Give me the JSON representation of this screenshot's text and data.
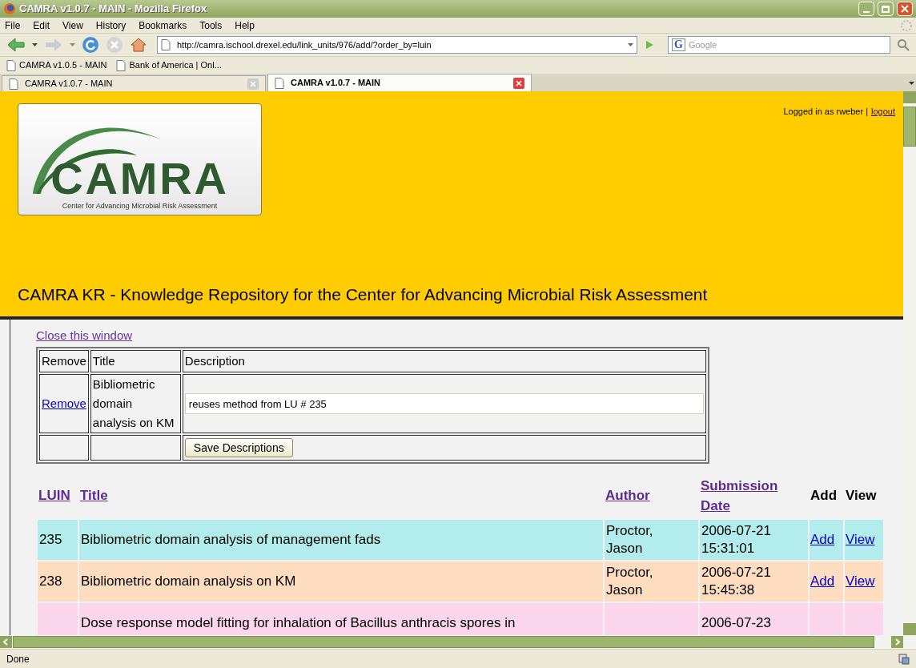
{
  "window": {
    "title": "CAMRA v1.0.7 - MAIN - Mozilla Firefox"
  },
  "menu": [
    "File",
    "Edit",
    "View",
    "History",
    "Bookmarks",
    "Tools",
    "Help"
  ],
  "address_bar": {
    "value": "http://camra.ischool.drexel.edu/link_units/976/add/?order_by=luin"
  },
  "search": {
    "engine": "G",
    "placeholder": "Google"
  },
  "bookmarks": [
    "CAMRA v1.0.5 - MAIN",
    "Bank of America | Onl..."
  ],
  "tabs": [
    {
      "label": "CAMRA v1.0.7 - MAIN",
      "selected": false
    },
    {
      "label": "CAMRA v1.0.7 - MAIN",
      "selected": true
    }
  ],
  "header": {
    "logo_text": "CAMRA",
    "logo_subtitle": "Center for Advancing Microbial Risk Assessment",
    "login_text": "Logged in as rweber |",
    "logout": "logout",
    "title": "CAMRA KR - Knowledge Repository for the Center for Advancing Microbial Risk Assessment"
  },
  "close_link": "Close this window",
  "selection_table": {
    "columns": [
      "Remove",
      "Title",
      "Description"
    ],
    "rows": [
      {
        "remove": "Remove",
        "title": "Bibliometric domain analysis on KM",
        "description": "reuses method from LU # 235"
      }
    ],
    "save_button": "Save Descriptions"
  },
  "results_table": {
    "columns": [
      {
        "label": "LUIN",
        "link": true
      },
      {
        "label": "Title",
        "link": true
      },
      {
        "label": "Author",
        "link": true
      },
      {
        "label": "Submission Date",
        "link": true
      },
      {
        "label": "Add",
        "link": false
      },
      {
        "label": "View",
        "link": false
      }
    ],
    "rows": [
      {
        "luin": "235",
        "title": "Bibliometric domain analysis of management fads",
        "author": "Proctor, Jason",
        "date": "2006-07-21 15:31:01",
        "add": "Add",
        "view": "View",
        "color": "#b3ecec"
      },
      {
        "luin": "238",
        "title": "Bibliometric domain analysis on KM",
        "author": "Proctor, Jason",
        "date": "2006-07-21 15:45:38",
        "add": "Add",
        "view": "View",
        "color": "#fddcbf"
      },
      {
        "title": "Dose response model fitting for inhalation of Bacillus anthracis spores in",
        "date": "2006-07-23",
        "color": "#fcd6ec"
      }
    ]
  },
  "status_bar": {
    "text": "Done"
  }
}
